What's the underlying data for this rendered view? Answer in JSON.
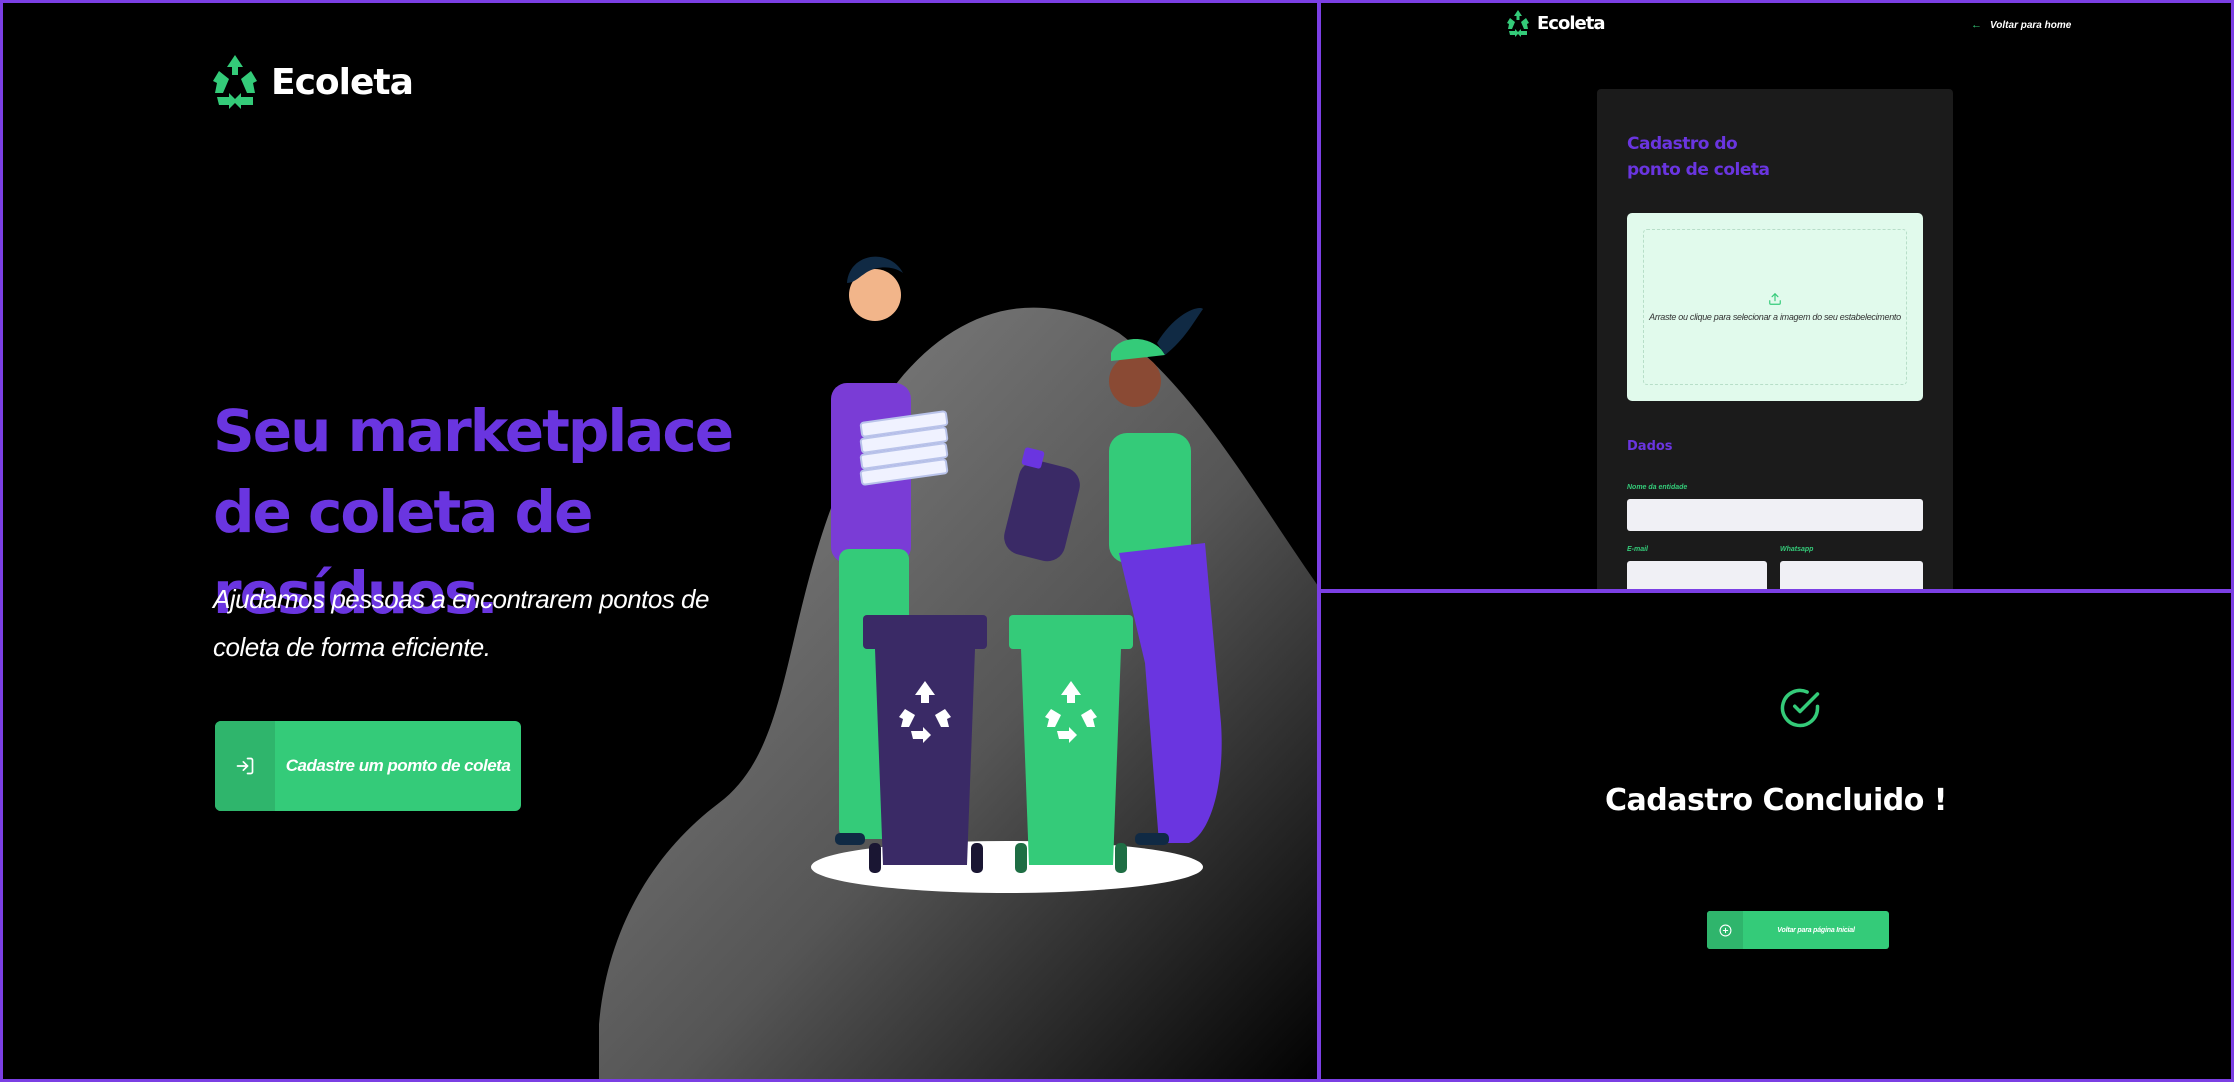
{
  "brand": {
    "name": "Ecoleta",
    "primary": "#34cb79",
    "accent": "#6a35e0",
    "frame": "#7b3fe4",
    "background": "#000000"
  },
  "home": {
    "title": "Seu marketplace de coleta de resíduos.",
    "subtitle": "Ajudamos pessoas a encontrarem pontos de coleta de forma eficiente.",
    "cta_label": "Cadastre um pomto de coleta",
    "cta_icon": "log-in-icon",
    "illustration": "recycling-people-illustration"
  },
  "form": {
    "back_label": "Voltar para home",
    "back_icon": "arrow-left-icon",
    "title": "Cadastro do ponto de coleta",
    "dropzone_text": "Arraste ou clique para selecionar a imagem do seu estabelecimento",
    "dropzone_icon": "upload-icon",
    "section_title": "Dados",
    "fields": {
      "name_label": "Nome da entidade",
      "email_label": "E-mail",
      "whatsapp_label": "Whatsapp"
    }
  },
  "done": {
    "title": "Cadastro Concluido !",
    "button_label": "Voltar para página Inicial",
    "check_icon": "check-circle-icon",
    "button_icon": "plus-circle-icon"
  }
}
